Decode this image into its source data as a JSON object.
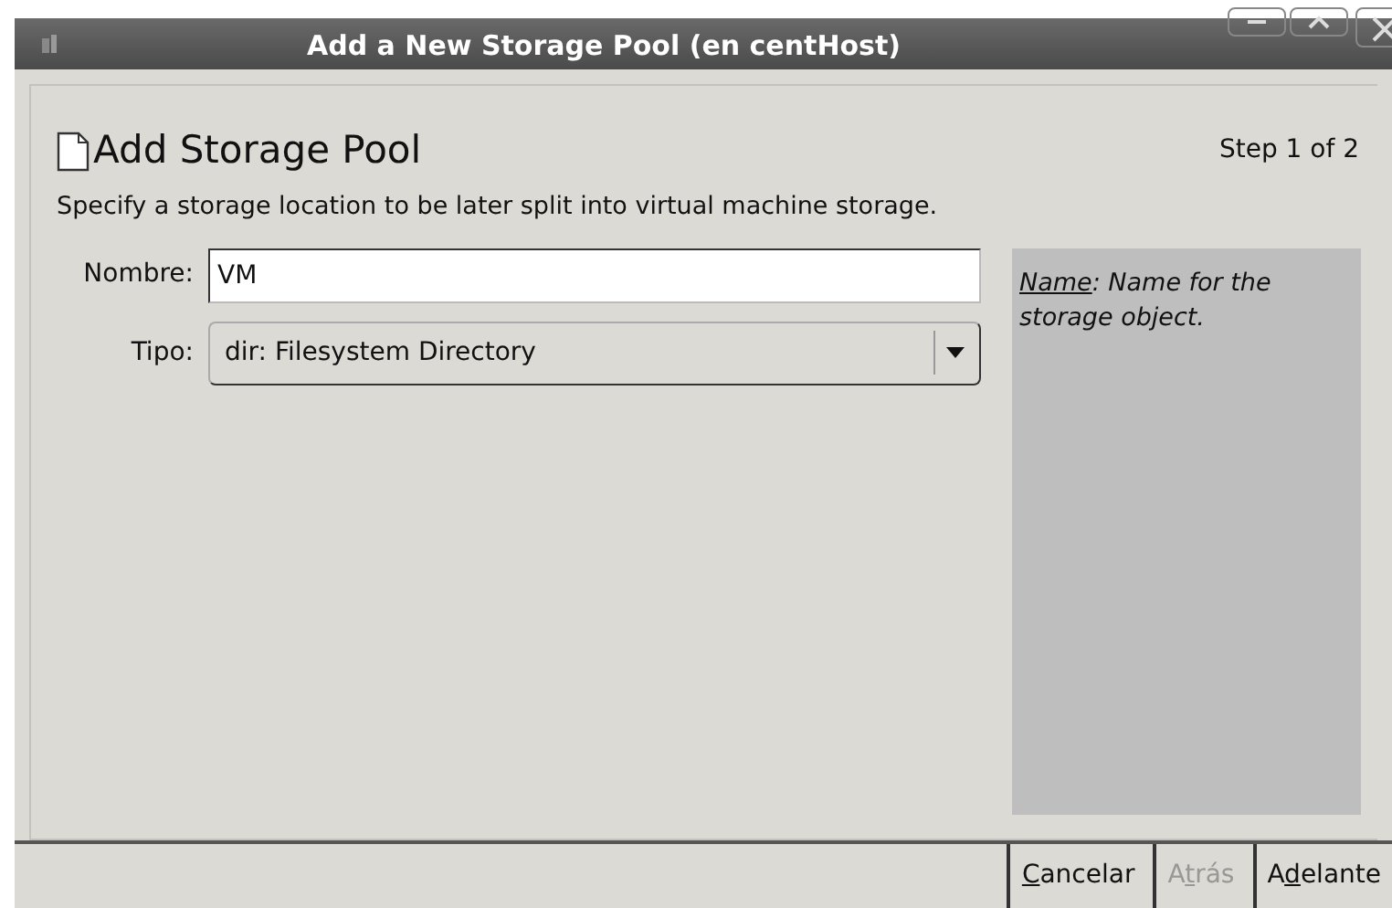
{
  "window": {
    "title": "Add a New Storage Pool (en centHost)"
  },
  "header": {
    "title": "Add Storage Pool",
    "step": "Step 1 of 2",
    "description": "Specify a storage location to be later split into virtual machine storage."
  },
  "form": [
    {
      "kind": "text",
      "label": "Nombre:",
      "value": "VM"
    },
    {
      "kind": "dropdown",
      "label": "Tipo:",
      "value": "dir: Filesystem Directory"
    }
  ],
  "help": {
    "term": "Name",
    "text": ": Name for the storage object."
  },
  "buttons": [
    {
      "key": "C",
      "post": "ancelar",
      "disabled": false
    },
    {
      "pre": "A",
      "key": "t",
      "post": "rás",
      "disabled": true
    },
    {
      "pre": "A",
      "key": "d",
      "post": "elante",
      "disabled": false
    }
  ]
}
